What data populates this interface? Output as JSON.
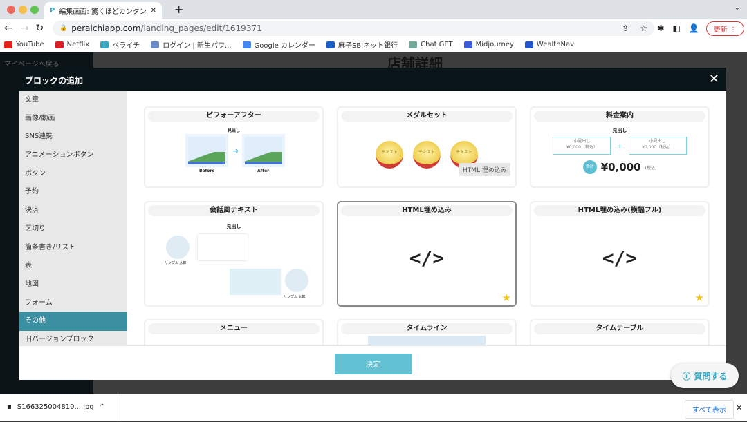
{
  "browser": {
    "tab_title": "編集画面: 驚くほどカンタン！無料",
    "url_host": "peraichiapp.com",
    "url_path": "/landing_pages/edit/1619371",
    "update_label": "更新",
    "bookmarks": [
      {
        "label": "YouTube",
        "color": "#e62117"
      },
      {
        "label": "Netflix",
        "color": "#d81f26"
      },
      {
        "label": "ペライチ",
        "color": "#3aa7c0"
      },
      {
        "label": "ログイン | 新生パワ...",
        "color": "#6b8cc7"
      },
      {
        "label": "Google カレンダー",
        "color": "#4285f4"
      },
      {
        "label": "麻子SBIネット銀行",
        "color": "#1a5fc8"
      },
      {
        "label": "Chat GPT",
        "color": "#74aa9c"
      },
      {
        "label": "Midjourney",
        "color": "#3b5bdb"
      },
      {
        "label": "WealthNavi",
        "color": "#2255cc"
      }
    ]
  },
  "background_page": {
    "title": "店舗詳細",
    "sidebar_back": "マイページへ戻る"
  },
  "modal": {
    "title": "ブロックの追加",
    "menu": [
      "文章",
      "画像/動画",
      "SNS連携",
      "アニメーションボタン",
      "ボタン",
      "予約",
      "決済",
      "区切り",
      "箇条書き/リスト",
      "表",
      "地図",
      "フォーム",
      "その他",
      "旧バージョンブロック"
    ],
    "selected_index": 12,
    "cards": [
      {
        "title": "ビフォーアフター",
        "heading": "見出し",
        "before": "Before",
        "after": "After"
      },
      {
        "title": "メダルセット",
        "medal_text": "テキスト"
      },
      {
        "title": "料金案内",
        "heading": "見出し",
        "sub": "小見出し",
        "price_small": "¥0,000（税込）",
        "total_label": "合計",
        "total": "¥0,000",
        "tax": "(税込)"
      },
      {
        "title": "会話風テキスト",
        "heading": "見出し",
        "name": "サンプル 太郎"
      },
      {
        "title": "HTML埋め込み",
        "code": "</>",
        "favorite": true
      },
      {
        "title": "HTML埋め込み(横幅フル)",
        "code": "</>",
        "favorite": true
      },
      {
        "title": "メニュー"
      },
      {
        "title": "タイムライン"
      },
      {
        "title": "タイムテーブル"
      }
    ],
    "tooltip": "HTML 埋め込み",
    "decide": "決定"
  },
  "help_button": "質問する",
  "download": {
    "file": "S166325004810....jpg",
    "show_all": "すべて表示"
  },
  "colors": {
    "accent": "#3a8fa0",
    "button": "#62c1d3"
  }
}
